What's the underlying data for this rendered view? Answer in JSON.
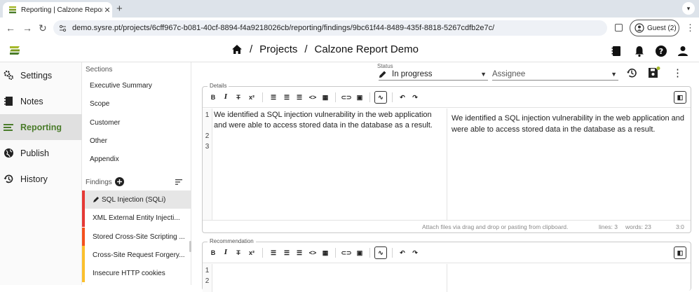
{
  "browser": {
    "tab_title": "Reporting | Calzone Report D",
    "new_tab": "+",
    "url": "demo.sysre.pt/projects/6cff967c-b081-40cf-8894-f4a9218026cb/reporting/findings/9bc61f44-8489-435f-8818-5267cdfb2e7c/",
    "profile_label": "Guest (2)"
  },
  "appbar": {
    "breadcrumb_sep": "/",
    "crumbs": [
      "Projects",
      "Calzone Report Demo"
    ]
  },
  "nav": {
    "items": [
      {
        "label": "Settings",
        "icon": "gears-icon"
      },
      {
        "label": "Notes",
        "icon": "notebook-icon"
      },
      {
        "label": "Reporting",
        "icon": "reporting-lines-icon"
      },
      {
        "label": "Publish",
        "icon": "globe-icon"
      },
      {
        "label": "History",
        "icon": "history-icon"
      }
    ],
    "active": "Reporting"
  },
  "sections": {
    "heading": "Sections",
    "items": [
      "Executive Summary",
      "Scope",
      "Customer",
      "Other",
      "Appendix"
    ],
    "findings_heading": "Findings",
    "findings": [
      {
        "label": "SQL Injection (SQLi)",
        "color": "#e53935",
        "selected": true
      },
      {
        "label": "XML External Entity Injecti...",
        "color": "#e53935",
        "selected": false
      },
      {
        "label": "Stored Cross-Site Scripting ...",
        "color": "#f4511e",
        "selected": false
      },
      {
        "label": "Cross-Site Request Forgery...",
        "color": "#fbc02d",
        "selected": false
      },
      {
        "label": "Insecure HTTP cookies",
        "color": "#fbc02d",
        "selected": false
      }
    ]
  },
  "status": {
    "label": "Status",
    "value": "In progress",
    "assignee_placeholder": "Assignee"
  },
  "details": {
    "legend": "Details",
    "line_numbers": [
      "1",
      "2",
      "3"
    ],
    "text": "We identified a SQL injection vulnerability in the web application and were able to access stored data in the database as a result.",
    "attach_hint": "Attach files via drag and drop or pasting from clipboard.",
    "lines": "lines: 3",
    "words": "words: 23",
    "cursor": "3:0"
  },
  "recommendation": {
    "legend": "Recommendation",
    "line_numbers": [
      "1",
      "2"
    ]
  },
  "toolbar_icons": [
    "bold-icon",
    "italic-icon",
    "strikethrough-icon",
    "superscript-icon",
    "bullet-list-icon",
    "numbered-list-icon",
    "task-list-icon",
    "code-icon",
    "table-icon",
    "link-icon",
    "image-icon",
    "spellcheck-icon",
    "undo-icon",
    "redo-icon",
    "toggle-preview-icon"
  ],
  "colors": {
    "accent": "#4a7c2a",
    "critical": "#e53935",
    "high": "#f4511e",
    "medium": "#fbc02d"
  }
}
